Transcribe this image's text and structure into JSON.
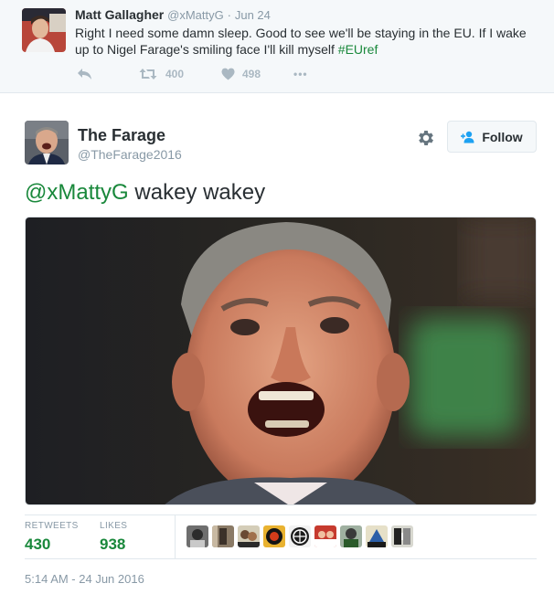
{
  "parent_tweet": {
    "author_name": "Matt Gallagher",
    "author_handle": "@xMattyG",
    "separator": "·",
    "date": "Jun 24",
    "text_before": "Right I need some damn sleep. Good to see we'll be staying in the EU. If I wake up to Nigel Farage's smiling face I'll kill myself ",
    "hashtag": "#EUref",
    "retweet_count": "400",
    "like_count": "498",
    "more_label": "•••",
    "icons": [
      "reply-icon",
      "retweet-icon",
      "heart-icon",
      "more-icon"
    ]
  },
  "tweet": {
    "author_name": "The Farage",
    "author_handle": "@TheFarage2016",
    "follow_label": "Follow",
    "mention": "@xMattyG",
    "text_rest": " wakey wakey",
    "retweets_label": "RETWEETS",
    "retweets_count": "430",
    "likes_label": "LIKES",
    "likes_count": "938",
    "timestamp": "5:14 AM - 24 Jun 2016",
    "liker_avatar_count": 9,
    "icons": [
      "gear-icon",
      "follow-person-icon"
    ]
  },
  "colors": {
    "accent_green": "#19883b",
    "muted_text": "#8899a6",
    "parent_bg": "#f5f8fa",
    "border": "#e1e8ed"
  }
}
